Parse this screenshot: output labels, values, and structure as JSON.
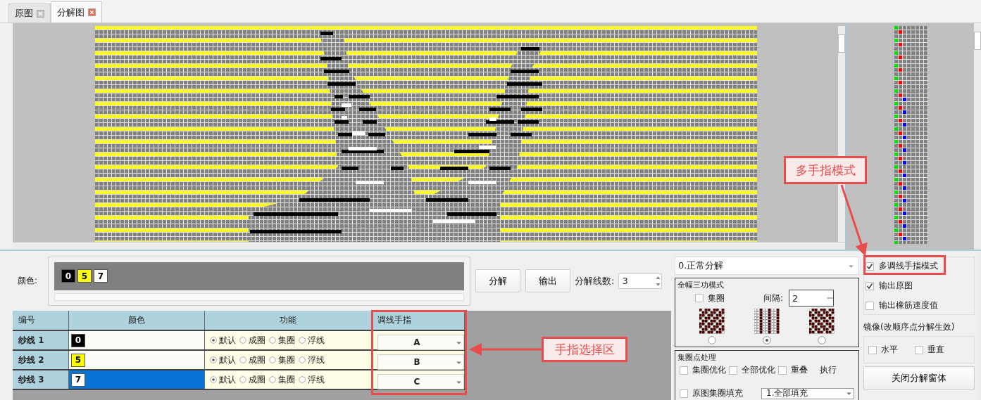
{
  "tabs": [
    {
      "label": "原图",
      "selected": false
    },
    {
      "label": "分解图",
      "selected": true
    }
  ],
  "color_bar": {
    "label": "颜色:",
    "chips": [
      {
        "text": "0",
        "color": "#000000"
      },
      {
        "text": "5",
        "color": "#ffff00"
      },
      {
        "text": "7",
        "color": "#ffffff"
      }
    ]
  },
  "buttons": [
    "分解",
    "输出"
  ],
  "thread_count": {
    "label": "分解线数:",
    "value": "3"
  },
  "table": {
    "columns": [
      "编号",
      "颜色",
      "功能",
      "调线手指"
    ],
    "rows": [
      {
        "name": "纱线 1",
        "code": "0",
        "color": "#000000",
        "selected": false,
        "functions": [
          {
            "label": "默认",
            "selected": true
          },
          {
            "label": "成圈",
            "selected": false
          },
          {
            "label": "集圈",
            "selected": false
          },
          {
            "label": "浮线",
            "selected": false
          }
        ],
        "finger": "A"
      },
      {
        "name": "纱线 2",
        "code": "5",
        "color": "#ffff00",
        "selected": false,
        "functions": [
          {
            "label": "默认",
            "selected": true
          },
          {
            "label": "成圈",
            "selected": false
          },
          {
            "label": "集圈",
            "selected": false
          },
          {
            "label": "浮线",
            "selected": false
          }
        ],
        "finger": "B"
      },
      {
        "name": "纱线 3",
        "code": "7",
        "color": "#ffffff",
        "selected": true,
        "functions": [
          {
            "label": "默认",
            "selected": true
          },
          {
            "label": "成圈",
            "selected": false
          },
          {
            "label": "集圈",
            "selected": false
          },
          {
            "label": "浮线",
            "selected": false
          }
        ],
        "finger": "C"
      }
    ]
  },
  "mode_dropdown": "0.正常分解",
  "full_width": {
    "title": "全幅三功模式",
    "tuck": {
      "label": "集圈",
      "checked": false
    },
    "interval": {
      "label": "间隔:",
      "value": "2"
    },
    "patterns": [
      {
        "kind": "diagonal",
        "selected": false
      },
      {
        "kind": "stripes",
        "selected": true
      },
      {
        "kind": "reverse",
        "selected": false
      }
    ]
  },
  "tuck_processing": {
    "title": "集圈点处理",
    "options": [
      {
        "label": "集圈优化",
        "checked": false
      },
      {
        "label": "全部优化",
        "checked": false
      },
      {
        "label": "重叠",
        "checked": false
      }
    ],
    "execute": "执行",
    "fill": {
      "label": "原图集圈填充",
      "checked": false
    },
    "fill_dropdown": "1.全部填充"
  },
  "options": [
    {
      "label": "多调线手指模式",
      "checked": true
    },
    {
      "label": "输出原图",
      "checked": true
    },
    {
      "label": "输出橡筋速度值",
      "checked": false
    }
  ],
  "mirror": {
    "title": "镜像(改顺序点分解生效)",
    "options": [
      {
        "label": "水平",
        "checked": false
      },
      {
        "label": "垂直",
        "checked": false
      }
    ]
  },
  "close_button": "关闭分解窗体",
  "annotations": [
    {
      "text": "多手指模式"
    },
    {
      "text": "手指选择区"
    }
  ]
}
